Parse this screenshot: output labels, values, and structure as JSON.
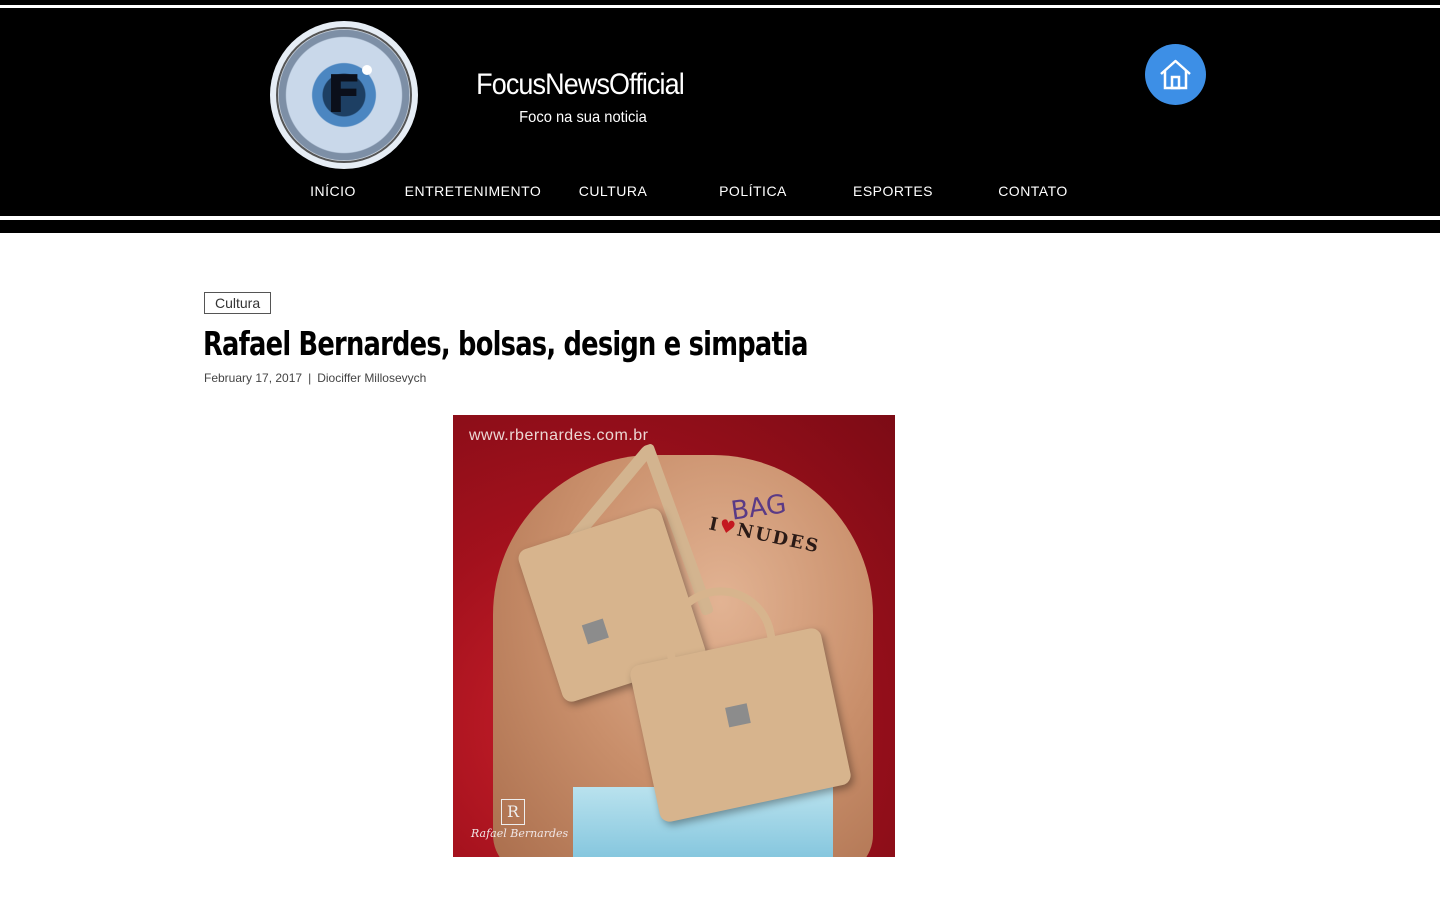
{
  "site": {
    "name": "FocusNewsOfficial",
    "tagline": "Foco na sua noticia"
  },
  "nav": {
    "items": [
      {
        "label": "INÍCIO"
      },
      {
        "label": "ENTRETENIMENTO"
      },
      {
        "label": "CULTURA"
      },
      {
        "label": "POLÍTICA"
      },
      {
        "label": "ESPORTES"
      },
      {
        "label": "CONTATO"
      }
    ]
  },
  "home_button": {
    "icon": "home-icon"
  },
  "article": {
    "category": "Cultura",
    "title": "Rafael Bernardes, bolsas, design e simpatia",
    "date": "February 17, 2017",
    "separator": "|",
    "author": "Diociffer Millosevych",
    "image": {
      "watermark_url": "www.rbernardes.com.br",
      "tattoo_bag": "BAG",
      "tattoo_love": "I",
      "tattoo_nudes": "NUDES",
      "brand_mark": "R",
      "brand_name": "Rafael Bernardes"
    }
  },
  "colors": {
    "header_bg": "#000000",
    "home_button": "#3d8fe6",
    "photo_bg": "#a3111d"
  }
}
